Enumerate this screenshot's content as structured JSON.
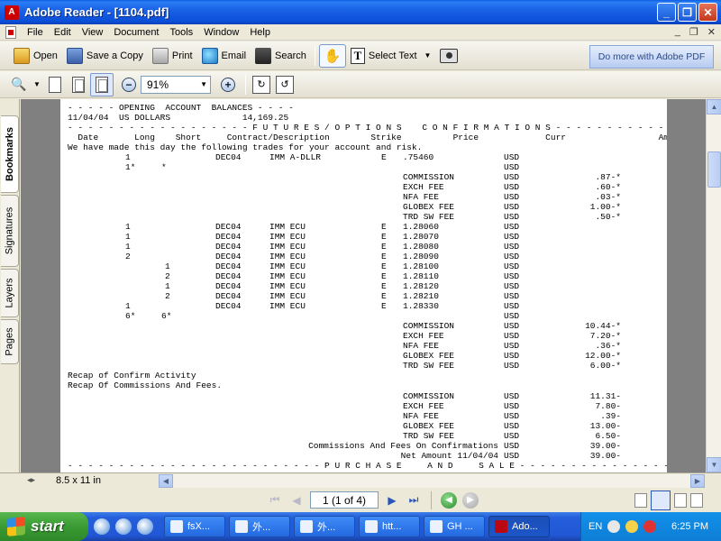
{
  "window": {
    "title": "Adobe Reader - [1104.pdf]"
  },
  "menu": [
    "File",
    "Edit",
    "View",
    "Document",
    "Tools",
    "Window",
    "Help"
  ],
  "toolbar": {
    "open": "Open",
    "save_copy": "Save a Copy",
    "print": "Print",
    "email": "Email",
    "search": "Search",
    "select_text": "Select Text",
    "adobe_pdf": "Do more with Adobe PDF"
  },
  "zoom": {
    "value": "91%"
  },
  "nav_tabs": [
    "Bookmarks",
    "Signatures",
    "Layers",
    "Pages"
  ],
  "document": {
    "header_lines": [
      "- - - - - OPENING  ACCOUNT  BALANCES - - - -",
      "11/04/04  US DOLLARS              14,169.25",
      "- - - - - - - - - - - - - - - - - - F U T U R E S / O P T I O N S    C O N F I R M A T I O N S - - - - - - - - - - - - - - - -",
      "  Date       Long    Short     Contract/Description        Strike          Price             Curr                  Amount",
      "We have made this day the following trades for your account and risk."
    ],
    "trades": [
      {
        "long": "1",
        "short": "",
        "contract": "DEC04",
        "desc": "IMM A-DLLR",
        "e": "E",
        "price": ".75460",
        "curr": "USD",
        "label": "",
        "amount": ""
      },
      {
        "long": "1*",
        "short": "*",
        "contract": "",
        "desc": "",
        "e": "",
        "price": "",
        "curr": "USD",
        "label": "",
        "amount": ""
      },
      {
        "long": "",
        "short": "",
        "contract": "",
        "desc": "",
        "e": "",
        "price": "",
        "curr": "USD",
        "label": "COMMISSION",
        "amount": ".87-*"
      },
      {
        "long": "",
        "short": "",
        "contract": "",
        "desc": "",
        "e": "",
        "price": "",
        "curr": "USD",
        "label": "EXCH FEE",
        "amount": ".60-*"
      },
      {
        "long": "",
        "short": "",
        "contract": "",
        "desc": "",
        "e": "",
        "price": "",
        "curr": "USD",
        "label": "NFA FEE",
        "amount": ".03-*"
      },
      {
        "long": "",
        "short": "",
        "contract": "",
        "desc": "",
        "e": "",
        "price": "",
        "curr": "USD",
        "label": "GLOBEX FEE",
        "amount": "1.00-*"
      },
      {
        "long": "",
        "short": "",
        "contract": "",
        "desc": "",
        "e": "",
        "price": "",
        "curr": "USD",
        "label": "TRD SW FEE",
        "amount": ".50-*"
      },
      {
        "long": "1",
        "short": "",
        "contract": "DEC04",
        "desc": "IMM ECU",
        "e": "E",
        "price": "1.28060",
        "curr": "USD",
        "label": "",
        "amount": ""
      },
      {
        "long": "1",
        "short": "",
        "contract": "DEC04",
        "desc": "IMM ECU",
        "e": "E",
        "price": "1.28070",
        "curr": "USD",
        "label": "",
        "amount": ""
      },
      {
        "long": "1",
        "short": "",
        "contract": "DEC04",
        "desc": "IMM ECU",
        "e": "E",
        "price": "1.28080",
        "curr": "USD",
        "label": "",
        "amount": ""
      },
      {
        "long": "2",
        "short": "",
        "contract": "DEC04",
        "desc": "IMM ECU",
        "e": "E",
        "price": "1.28090",
        "curr": "USD",
        "label": "",
        "amount": ""
      },
      {
        "long": "",
        "short": "1",
        "contract": "DEC04",
        "desc": "IMM ECU",
        "e": "E",
        "price": "1.28100",
        "curr": "USD",
        "label": "",
        "amount": ""
      },
      {
        "long": "",
        "short": "2",
        "contract": "DEC04",
        "desc": "IMM ECU",
        "e": "E",
        "price": "1.28110",
        "curr": "USD",
        "label": "",
        "amount": ""
      },
      {
        "long": "",
        "short": "1",
        "contract": "DEC04",
        "desc": "IMM ECU",
        "e": "E",
        "price": "1.28120",
        "curr": "USD",
        "label": "",
        "amount": ""
      },
      {
        "long": "",
        "short": "2",
        "contract": "DEC04",
        "desc": "IMM ECU",
        "e": "E",
        "price": "1.28210",
        "curr": "USD",
        "label": "",
        "amount": ""
      },
      {
        "long": "1",
        "short": "",
        "contract": "DEC04",
        "desc": "IMM ECU",
        "e": "E",
        "price": "1.28330",
        "curr": "USD",
        "label": "",
        "amount": ""
      },
      {
        "long": "6*",
        "short": "6*",
        "contract": "",
        "desc": "",
        "e": "",
        "price": "",
        "curr": "USD",
        "label": "",
        "amount": ""
      },
      {
        "long": "",
        "short": "",
        "contract": "",
        "desc": "",
        "e": "",
        "price": "",
        "curr": "USD",
        "label": "COMMISSION",
        "amount": "10.44-*"
      },
      {
        "long": "",
        "short": "",
        "contract": "",
        "desc": "",
        "e": "",
        "price": "",
        "curr": "USD",
        "label": "EXCH FEE",
        "amount": "7.20-*"
      },
      {
        "long": "",
        "short": "",
        "contract": "",
        "desc": "",
        "e": "",
        "price": "",
        "curr": "USD",
        "label": "NFA FEE",
        "amount": ".36-*"
      },
      {
        "long": "",
        "short": "",
        "contract": "",
        "desc": "",
        "e": "",
        "price": "",
        "curr": "USD",
        "label": "GLOBEX FEE",
        "amount": "12.00-*"
      },
      {
        "long": "",
        "short": "",
        "contract": "",
        "desc": "",
        "e": "",
        "price": "",
        "curr": "USD",
        "label": "TRD SW FEE",
        "amount": "6.00-*"
      }
    ],
    "recap_lines": [
      "Recap of Confirm Activity",
      "Recap Of Commissions And Fees."
    ],
    "recap_fees": [
      {
        "label": "COMMISSION",
        "curr": "USD",
        "amount": "11.31-"
      },
      {
        "label": "EXCH FEE",
        "curr": "USD",
        "amount": "7.80-"
      },
      {
        "label": "NFA FEE",
        "curr": "USD",
        "amount": ".39-"
      },
      {
        "label": "GLOBEX FEE",
        "curr": "USD",
        "amount": "13.00-"
      },
      {
        "label": "TRD SW FEE",
        "curr": "USD",
        "amount": "6.50-"
      }
    ],
    "totals": [
      {
        "label": "Commissions And Fees On Confirmations",
        "curr": "USD",
        "amount": "39.00-"
      },
      {
        "label": "Net Amount 11/04/04",
        "curr": "USD",
        "amount": "39.00-"
      }
    ],
    "footer_line": "- - - - - - - - - - - - - - - - - - - - - - - - - P U R C H A S E     A N D     S A L E - - - - - - - - - - - - - - - - -"
  },
  "page_size": "8.5 x 11 in",
  "page_nav": {
    "current": "1 (1 of 4)"
  },
  "taskbar": {
    "start": "start",
    "items": [
      "fsX...",
      "外...",
      "外...",
      "htt...",
      "GH ...",
      "Ado..."
    ],
    "lang": "EN",
    "clock": "6:25 PM"
  }
}
